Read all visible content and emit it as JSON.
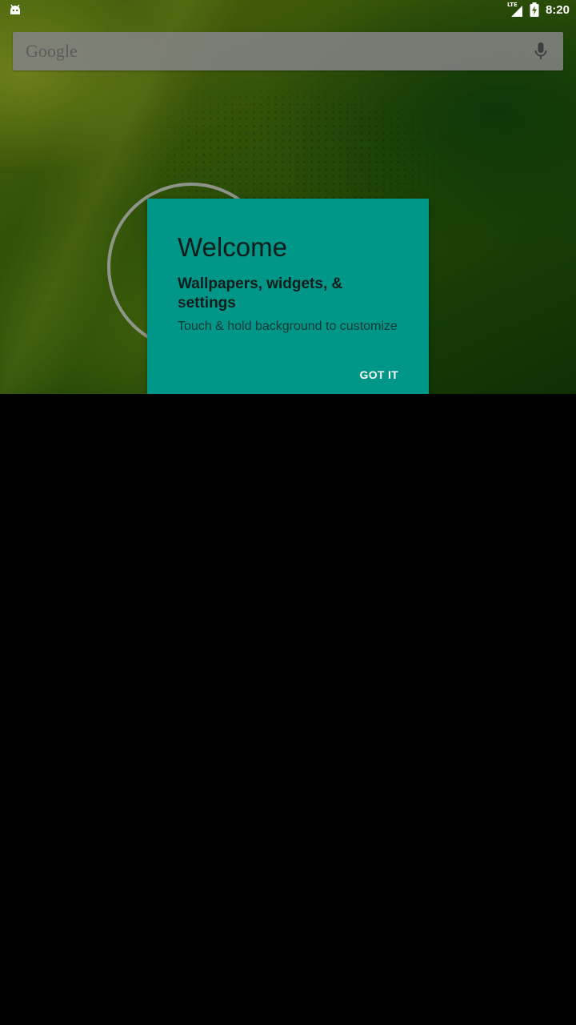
{
  "status_bar": {
    "left_icon": "android-debug-icon",
    "network_label": "LTE",
    "signal_icon": "cell-signal-icon",
    "battery_icon": "battery-charging-icon",
    "time": "8:20"
  },
  "search_bar": {
    "logo_text": "Google",
    "mic_icon": "microphone-icon"
  },
  "welcome_card": {
    "title": "Welcome",
    "subtitle": "Wallpapers, widgets, & settings",
    "body": "Touch & hold background to customize",
    "action_label": "GOT IT",
    "background_color": "#009688"
  }
}
